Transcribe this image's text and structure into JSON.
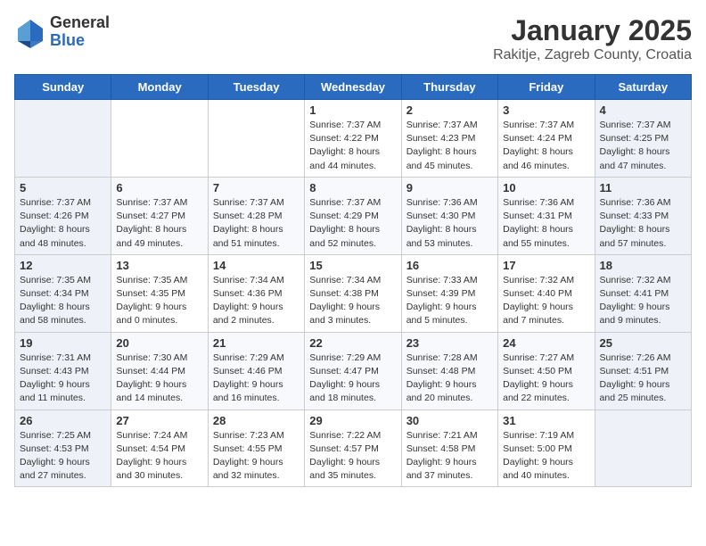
{
  "app": {
    "logo_general": "General",
    "logo_blue": "Blue",
    "title": "January 2025",
    "subtitle": "Rakitje, Zagreb County, Croatia"
  },
  "calendar": {
    "headers": [
      "Sunday",
      "Monday",
      "Tuesday",
      "Wednesday",
      "Thursday",
      "Friday",
      "Saturday"
    ],
    "weeks": [
      [
        {
          "day": "",
          "info": ""
        },
        {
          "day": "",
          "info": ""
        },
        {
          "day": "",
          "info": ""
        },
        {
          "day": "1",
          "info": "Sunrise: 7:37 AM\nSunset: 4:22 PM\nDaylight: 8 hours\nand 44 minutes."
        },
        {
          "day": "2",
          "info": "Sunrise: 7:37 AM\nSunset: 4:23 PM\nDaylight: 8 hours\nand 45 minutes."
        },
        {
          "day": "3",
          "info": "Sunrise: 7:37 AM\nSunset: 4:24 PM\nDaylight: 8 hours\nand 46 minutes."
        },
        {
          "day": "4",
          "info": "Sunrise: 7:37 AM\nSunset: 4:25 PM\nDaylight: 8 hours\nand 47 minutes."
        }
      ],
      [
        {
          "day": "5",
          "info": "Sunrise: 7:37 AM\nSunset: 4:26 PM\nDaylight: 8 hours\nand 48 minutes."
        },
        {
          "day": "6",
          "info": "Sunrise: 7:37 AM\nSunset: 4:27 PM\nDaylight: 8 hours\nand 49 minutes."
        },
        {
          "day": "7",
          "info": "Sunrise: 7:37 AM\nSunset: 4:28 PM\nDaylight: 8 hours\nand 51 minutes."
        },
        {
          "day": "8",
          "info": "Sunrise: 7:37 AM\nSunset: 4:29 PM\nDaylight: 8 hours\nand 52 minutes."
        },
        {
          "day": "9",
          "info": "Sunrise: 7:36 AM\nSunset: 4:30 PM\nDaylight: 8 hours\nand 53 minutes."
        },
        {
          "day": "10",
          "info": "Sunrise: 7:36 AM\nSunset: 4:31 PM\nDaylight: 8 hours\nand 55 minutes."
        },
        {
          "day": "11",
          "info": "Sunrise: 7:36 AM\nSunset: 4:33 PM\nDaylight: 8 hours\nand 57 minutes."
        }
      ],
      [
        {
          "day": "12",
          "info": "Sunrise: 7:35 AM\nSunset: 4:34 PM\nDaylight: 8 hours\nand 58 minutes."
        },
        {
          "day": "13",
          "info": "Sunrise: 7:35 AM\nSunset: 4:35 PM\nDaylight: 9 hours\nand 0 minutes."
        },
        {
          "day": "14",
          "info": "Sunrise: 7:34 AM\nSunset: 4:36 PM\nDaylight: 9 hours\nand 2 minutes."
        },
        {
          "day": "15",
          "info": "Sunrise: 7:34 AM\nSunset: 4:38 PM\nDaylight: 9 hours\nand 3 minutes."
        },
        {
          "day": "16",
          "info": "Sunrise: 7:33 AM\nSunset: 4:39 PM\nDaylight: 9 hours\nand 5 minutes."
        },
        {
          "day": "17",
          "info": "Sunrise: 7:32 AM\nSunset: 4:40 PM\nDaylight: 9 hours\nand 7 minutes."
        },
        {
          "day": "18",
          "info": "Sunrise: 7:32 AM\nSunset: 4:41 PM\nDaylight: 9 hours\nand 9 minutes."
        }
      ],
      [
        {
          "day": "19",
          "info": "Sunrise: 7:31 AM\nSunset: 4:43 PM\nDaylight: 9 hours\nand 11 minutes."
        },
        {
          "day": "20",
          "info": "Sunrise: 7:30 AM\nSunset: 4:44 PM\nDaylight: 9 hours\nand 14 minutes."
        },
        {
          "day": "21",
          "info": "Sunrise: 7:29 AM\nSunset: 4:46 PM\nDaylight: 9 hours\nand 16 minutes."
        },
        {
          "day": "22",
          "info": "Sunrise: 7:29 AM\nSunset: 4:47 PM\nDaylight: 9 hours\nand 18 minutes."
        },
        {
          "day": "23",
          "info": "Sunrise: 7:28 AM\nSunset: 4:48 PM\nDaylight: 9 hours\nand 20 minutes."
        },
        {
          "day": "24",
          "info": "Sunrise: 7:27 AM\nSunset: 4:50 PM\nDaylight: 9 hours\nand 22 minutes."
        },
        {
          "day": "25",
          "info": "Sunrise: 7:26 AM\nSunset: 4:51 PM\nDaylight: 9 hours\nand 25 minutes."
        }
      ],
      [
        {
          "day": "26",
          "info": "Sunrise: 7:25 AM\nSunset: 4:53 PM\nDaylight: 9 hours\nand 27 minutes."
        },
        {
          "day": "27",
          "info": "Sunrise: 7:24 AM\nSunset: 4:54 PM\nDaylight: 9 hours\nand 30 minutes."
        },
        {
          "day": "28",
          "info": "Sunrise: 7:23 AM\nSunset: 4:55 PM\nDaylight: 9 hours\nand 32 minutes."
        },
        {
          "day": "29",
          "info": "Sunrise: 7:22 AM\nSunset: 4:57 PM\nDaylight: 9 hours\nand 35 minutes."
        },
        {
          "day": "30",
          "info": "Sunrise: 7:21 AM\nSunset: 4:58 PM\nDaylight: 9 hours\nand 37 minutes."
        },
        {
          "day": "31",
          "info": "Sunrise: 7:19 AM\nSunset: 5:00 PM\nDaylight: 9 hours\nand 40 minutes."
        },
        {
          "day": "",
          "info": ""
        }
      ]
    ]
  }
}
